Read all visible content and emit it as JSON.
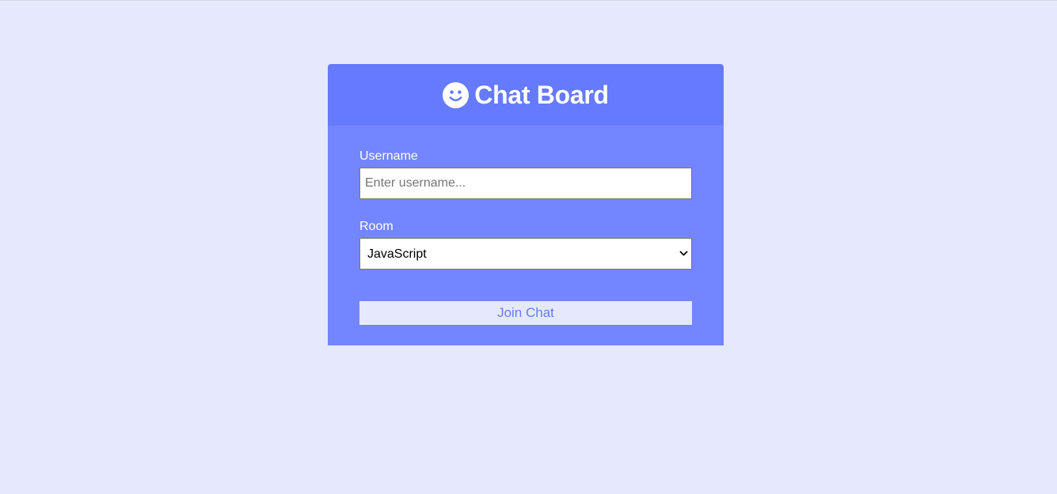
{
  "header": {
    "title": "Chat Board",
    "icon": "smiley-icon"
  },
  "form": {
    "username": {
      "label": "Username",
      "placeholder": "Enter username...",
      "value": ""
    },
    "room": {
      "label": "Room",
      "selected": "JavaScript"
    },
    "submit_label": "Join Chat"
  },
  "colors": {
    "page_background": "#e6e9fd",
    "header_background": "#667aff",
    "form_background": "#7386ff",
    "button_text": "#667aff"
  }
}
